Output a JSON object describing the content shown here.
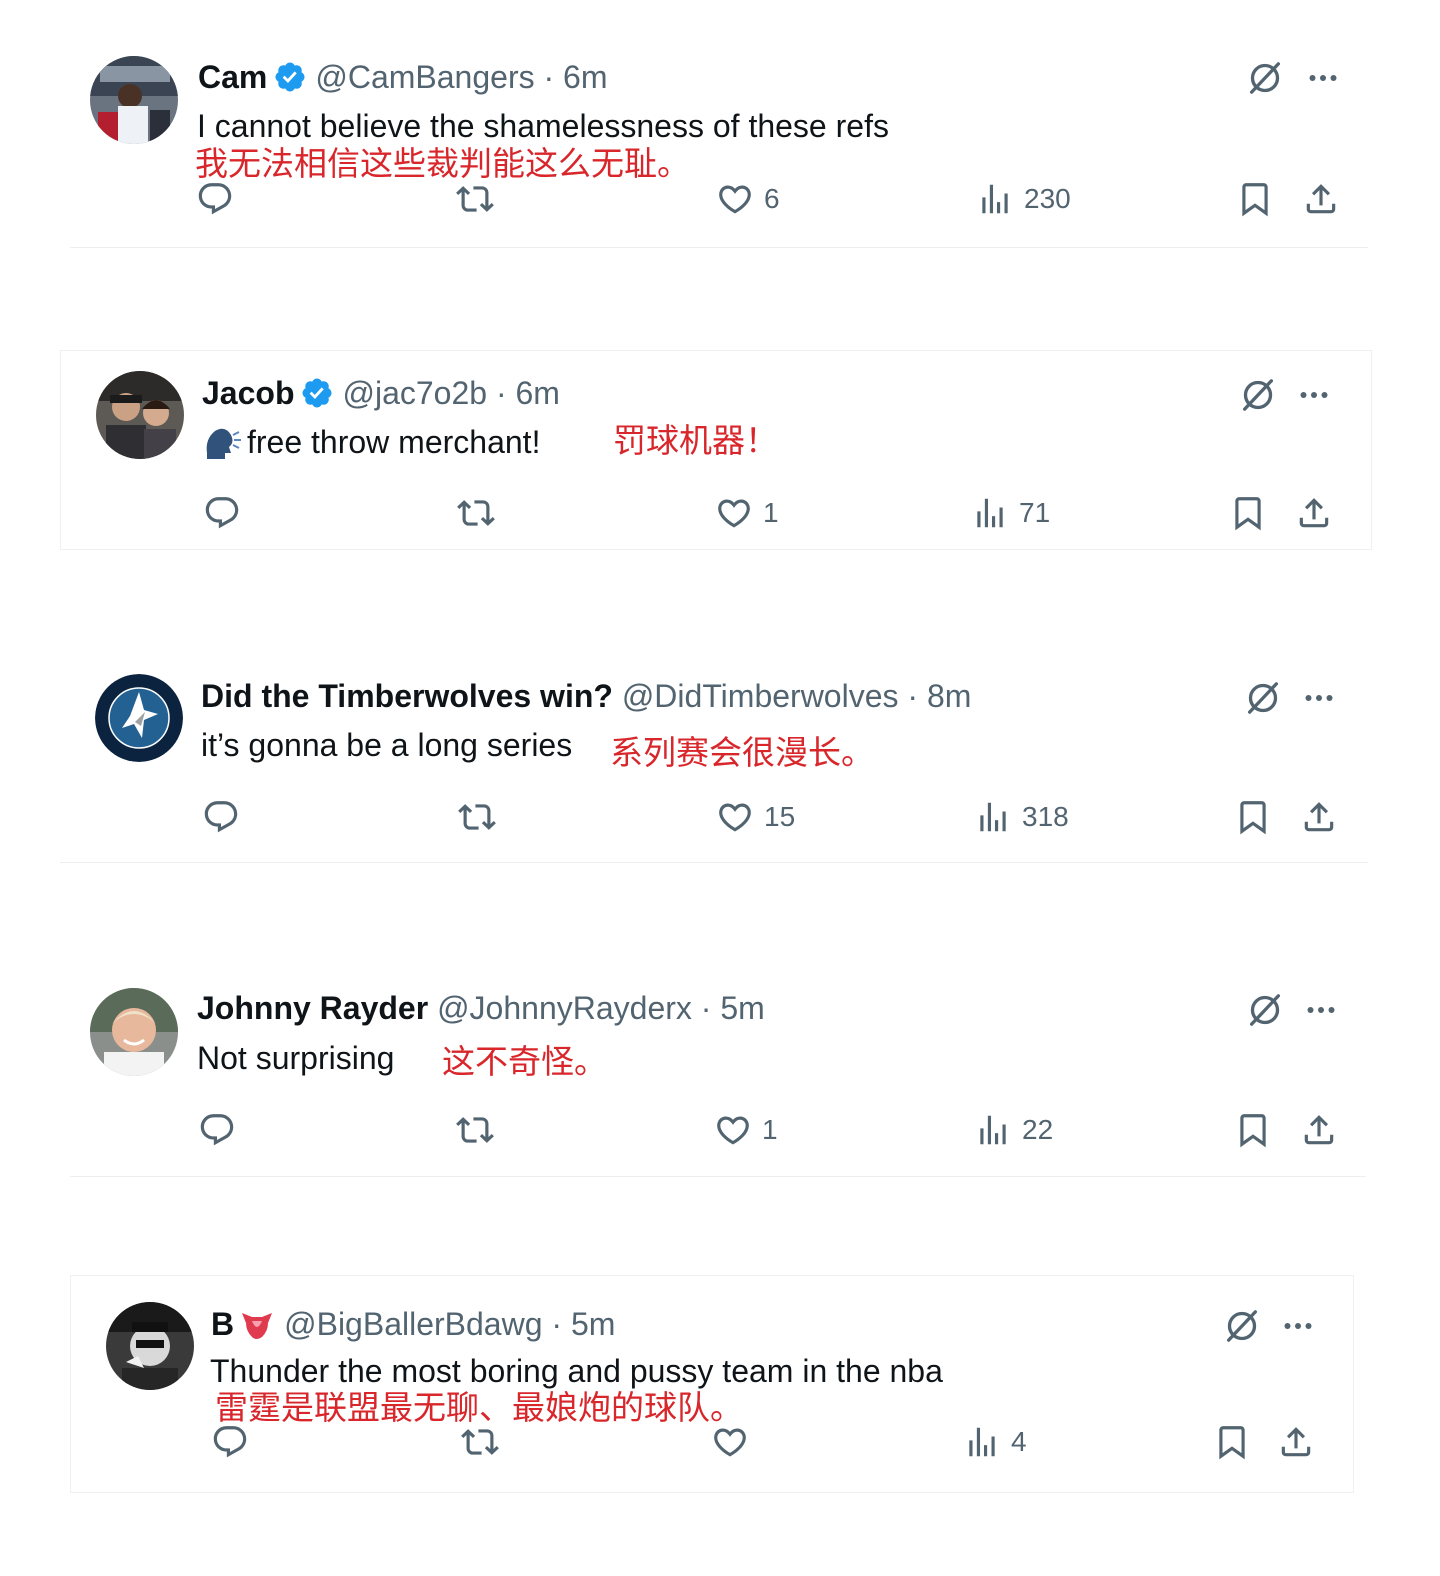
{
  "tweets": [
    {
      "name": "Cam",
      "handle": "@CamBangers",
      "time": "· 6m",
      "verified": true,
      "text": "I cannot believe the shamelessness of these refs",
      "translation": "我无法相信这些裁判能这么无耻。",
      "likes": "6",
      "views": "230"
    },
    {
      "name": "Jacob",
      "handle": "@jac7o2b",
      "time": "· 6m",
      "verified": true,
      "text": "free throw merchant!",
      "text_emoji": "speaking-head-emoji",
      "translation": "罚球机器！",
      "likes": "1",
      "views": "71"
    },
    {
      "name": "Did the Timberwolves win?",
      "handle": "@DidTimberwolves",
      "time": "· 8m",
      "verified": false,
      "text": "it’s gonna be a long series",
      "translation": "系列赛会很漫长。",
      "likes": "15",
      "views": "318"
    },
    {
      "name": "Johnny Rayder",
      "handle": "@JohnnyRayderx",
      "time": "· 5m",
      "verified": false,
      "text": "Not surprising",
      "translation": "这不奇怪。",
      "likes": "1",
      "views": "22"
    },
    {
      "name": "B",
      "name_emoji": "tongue-emoji",
      "handle": "@BigBallerBdawg",
      "time": "· 5m",
      "verified": false,
      "text": "Thunder the most boring and pussy team in the nba",
      "translation": "雷霆是联盟最无聊、最娘炮的球队。",
      "likes": "",
      "views": "4"
    }
  ],
  "colors": {
    "verified": "#1d9bf0",
    "icon": "#536471",
    "translation": "#d8262b"
  },
  "icons": [
    "reply-icon",
    "retweet-icon",
    "like-icon",
    "views-icon",
    "bookmark-icon",
    "share-icon",
    "grok-icon",
    "more-icon",
    "verified-badge-icon"
  ]
}
